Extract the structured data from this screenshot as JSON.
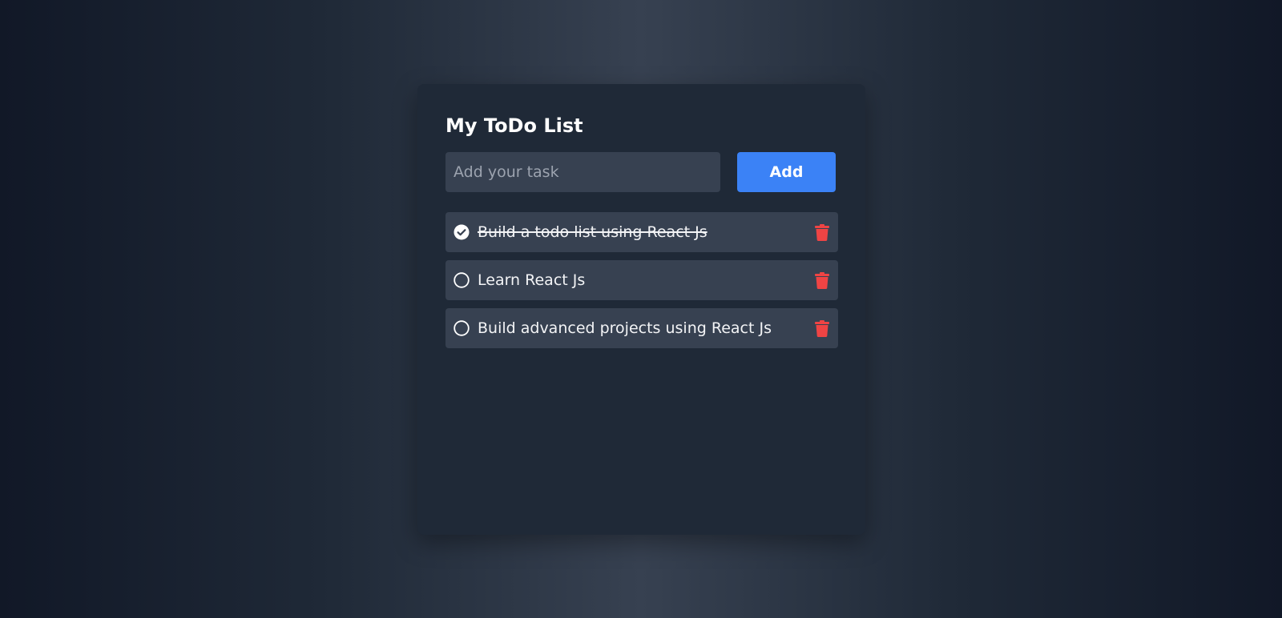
{
  "app": {
    "title": "My ToDo List"
  },
  "input": {
    "placeholder": "Add your task",
    "value": ""
  },
  "add_button": {
    "label": "Add"
  },
  "tasks": [
    {
      "text": "Build a todo list using React Js",
      "completed": true
    },
    {
      "text": "Learn React Js",
      "completed": false
    },
    {
      "text": "Build advanced projects using React Js",
      "completed": false
    }
  ],
  "icons": {
    "complete": "check-circle-icon",
    "incomplete": "empty-circle-icon",
    "delete": "trash-icon"
  },
  "colors": {
    "accent": "#3b82f6",
    "delete": "#ef4444",
    "card": "#1f2937",
    "item": "#374151"
  }
}
